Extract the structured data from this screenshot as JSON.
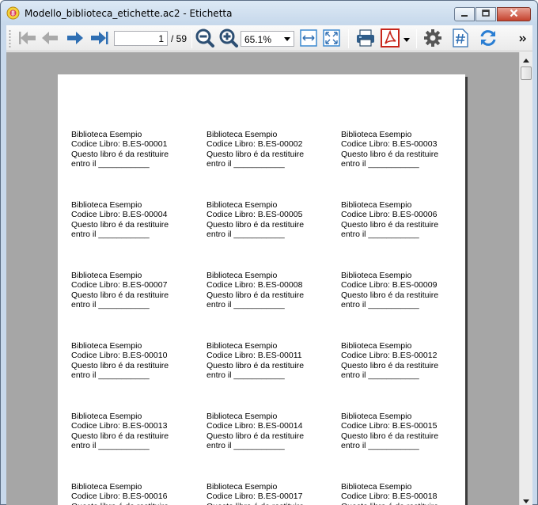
{
  "window": {
    "title": "Modello_biblioteca_etichette.ac2 - Etichetta",
    "app_icon": "app-logo-icon",
    "buttons": [
      "minimize-icon",
      "maximize-icon",
      "close-icon"
    ]
  },
  "toolbar": {
    "icons": {
      "first": "arrow-first-icon",
      "prev": "arrow-left-icon",
      "next": "arrow-right-icon",
      "last": "arrow-last-icon",
      "zoom_out": "zoom-out-icon",
      "zoom_in": "zoom-in-icon",
      "fit_width": "fit-width-icon",
      "fit_page": "fit-page-icon",
      "print": "printer-icon",
      "pdf": "pdf-icon",
      "settings": "gear-icon",
      "page_number": "hash-icon",
      "refresh": "refresh-icon",
      "more": "chevron-more-icon"
    },
    "page_value": "1",
    "page_total": "/ 59",
    "zoom_value": "65.1%"
  },
  "labels": [
    {
      "line1": "Biblioteca Esempio",
      "line2": "Codice Libro: B.ES-00001",
      "line3": "Questo libro é da restituire",
      "line4": "entro il ___________"
    },
    {
      "line1": "Biblioteca Esempio",
      "line2": "Codice Libro: B.ES-00002",
      "line3": "Questo libro é da restituire",
      "line4": "entro il ___________"
    },
    {
      "line1": "Biblioteca Esempio",
      "line2": "Codice Libro: B.ES-00003",
      "line3": "Questo libro é da restituire",
      "line4": "entro il ___________"
    },
    {
      "line1": "Biblioteca Esempio",
      "line2": "Codice Libro: B.ES-00004",
      "line3": "Questo libro é da restituire",
      "line4": "entro il ___________"
    },
    {
      "line1": "Biblioteca Esempio",
      "line2": "Codice Libro: B.ES-00005",
      "line3": "Questo libro é da restituire",
      "line4": "entro il ___________"
    },
    {
      "line1": "Biblioteca Esempio",
      "line2": "Codice Libro: B.ES-00006",
      "line3": "Questo libro é da restituire",
      "line4": "entro il ___________"
    },
    {
      "line1": "Biblioteca Esempio",
      "line2": "Codice Libro: B.ES-00007",
      "line3": "Questo libro é da restituire",
      "line4": "entro il ___________"
    },
    {
      "line1": "Biblioteca Esempio",
      "line2": "Codice Libro: B.ES-00008",
      "line3": "Questo libro é da restituire",
      "line4": "entro il ___________"
    },
    {
      "line1": "Biblioteca Esempio",
      "line2": "Codice Libro: B.ES-00009",
      "line3": "Questo libro é da restituire",
      "line4": "entro il ___________"
    },
    {
      "line1": "Biblioteca Esempio",
      "line2": "Codice Libro: B.ES-00010",
      "line3": "Questo libro é da restituire",
      "line4": "entro il ___________"
    },
    {
      "line1": "Biblioteca Esempio",
      "line2": "Codice Libro: B.ES-00011",
      "line3": "Questo libro é da restituire",
      "line4": "entro il ___________"
    },
    {
      "line1": "Biblioteca Esempio",
      "line2": "Codice Libro: B.ES-00012",
      "line3": "Questo libro é da restituire",
      "line4": "entro il ___________"
    },
    {
      "line1": "Biblioteca Esempio",
      "line2": "Codice Libro: B.ES-00013",
      "line3": "Questo libro é da restituire",
      "line4": "entro il ___________"
    },
    {
      "line1": "Biblioteca Esempio",
      "line2": "Codice Libro: B.ES-00014",
      "line3": "Questo libro é da restituire",
      "line4": "entro il ___________"
    },
    {
      "line1": "Biblioteca Esempio",
      "line2": "Codice Libro: B.ES-00015",
      "line3": "Questo libro é da restituire",
      "line4": "entro il ___________"
    },
    {
      "line1": "Biblioteca Esempio",
      "line2": "Codice Libro: B.ES-00016",
      "line3": "Questo libro é da restituire",
      "line4": ""
    },
    {
      "line1": "Biblioteca Esempio",
      "line2": "Codice Libro: B.ES-00017",
      "line3": "Questo libro é da restituire",
      "line4": ""
    },
    {
      "line1": "Biblioteca Esempio",
      "line2": "Codice Libro: B.ES-00018",
      "line3": "Questo libro é da restituire",
      "line4": ""
    }
  ],
  "scrollbar": {
    "up_icon": "scroll-up-icon",
    "down_icon": "scroll-down-icon"
  },
  "colors": {
    "nav_arrow_active": "#2f6fb3",
    "nav_arrow_disabled": "#a9a9a9",
    "pdf_red": "#c8261b",
    "refresh_blue": "#2a7ed3",
    "viewport_gray": "#a6a6a6"
  }
}
